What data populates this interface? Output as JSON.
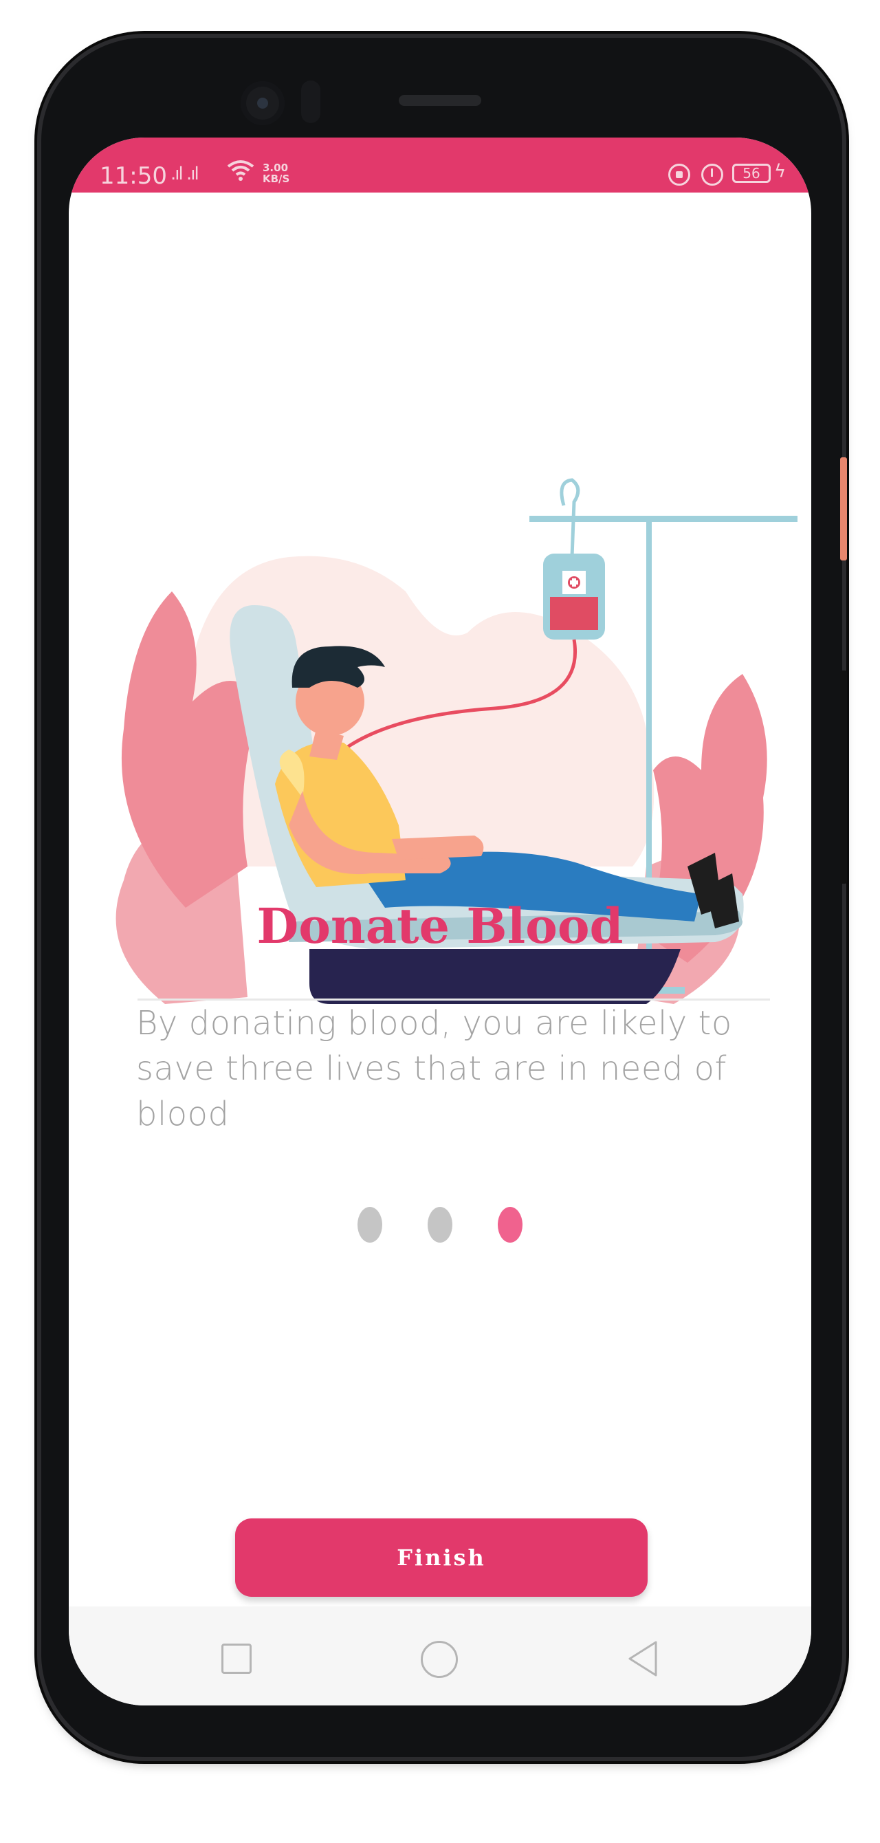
{
  "status_bar": {
    "time": "11:50",
    "signal": ".ıl .ıl",
    "net_speed_value": "3.00",
    "net_speed_unit": "KB/S",
    "battery": "56",
    "charging_symbol": "ϟ"
  },
  "onboarding": {
    "title": "Donate Blood",
    "description": "By donating blood, you are likely to save three lives that are in need of blood",
    "pages_total": 3,
    "current_page": 3
  },
  "finish_button": {
    "label": "Finish"
  },
  "colors": {
    "accent": "#e2396b",
    "dot_active": "#f0628e",
    "dot_inactive": "#c5c5c5",
    "description_text": "#a3a3a3"
  },
  "icons": {
    "illustration": "blood-donation-illustration",
    "nav": [
      "recent-apps-icon",
      "home-icon",
      "back-icon"
    ],
    "status": [
      "signal-icon",
      "wifi-icon",
      "lock-icon",
      "alarm-icon",
      "battery-icon",
      "charging-icon"
    ]
  }
}
